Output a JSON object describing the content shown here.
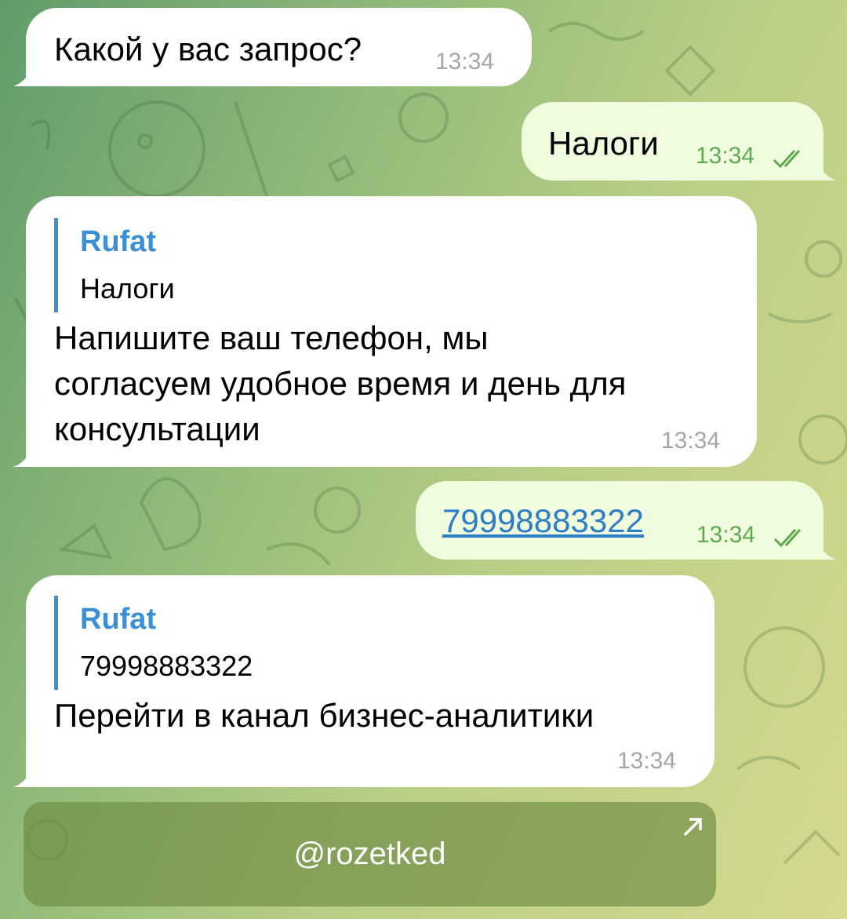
{
  "chat": {
    "messages": [
      {
        "direction": "incoming",
        "text": "Какой у вас запрос?",
        "time": "13:34"
      },
      {
        "direction": "outgoing",
        "text": "Налоги",
        "time": "13:34",
        "status": "read"
      },
      {
        "direction": "incoming",
        "reply_to": {
          "sender": "Rufat",
          "text": "Налоги"
        },
        "lines": [
          "Напишите ваш телефон, мы",
          "согласуем удобное время и день для",
          "консультации"
        ],
        "time": "13:34"
      },
      {
        "direction": "outgoing",
        "text": "79998883322",
        "is_link": true,
        "time": "13:34",
        "status": "read"
      },
      {
        "direction": "incoming",
        "reply_to": {
          "sender": "Rufat",
          "text": "79998883322"
        },
        "text": "Перейти в канал бизнес-аналитики",
        "time": "13:34"
      }
    ],
    "inline_button": {
      "label": "@rozetked",
      "icon": "external-arrow-icon"
    }
  },
  "colors": {
    "incoming_bubble": "#ffffff",
    "outgoing_bubble": "#effdde",
    "link": "#2f7dc4",
    "reply_accent": "#3a8fd6",
    "read_check": "#5fa94e"
  }
}
